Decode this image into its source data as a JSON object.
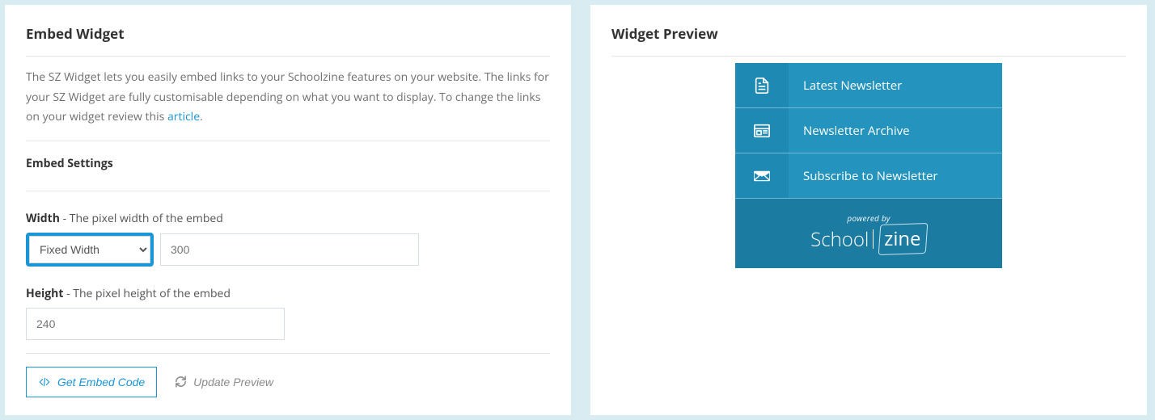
{
  "left": {
    "title": "Embed Widget",
    "desc_prefix": "The SZ Widget lets you easily embed links to your Schoolzine features on your website. The links for your SZ Widget are fully customisable depending on what you want to display. To change the links on your widget review this ",
    "desc_link_text": "article",
    "desc_suffix": ".",
    "settings_title": "Embed Settings",
    "width_label_strong": "Width",
    "width_label_rest": " - The pixel width of the embed",
    "width_select_value": "Fixed Width",
    "width_value": "300",
    "height_label_strong": "Height",
    "height_label_rest": " - The pixel height of the embed",
    "height_value": "240",
    "get_code_label": "Get Embed Code",
    "update_preview_label": "Update Preview"
  },
  "right": {
    "title": "Widget Preview",
    "rows": [
      {
        "label": "Latest Newsletter"
      },
      {
        "label": "Newsletter Archive"
      },
      {
        "label": "Subscribe to Newsletter"
      }
    ],
    "powered_by": "powered by",
    "brand_left": "School",
    "brand_right": "zine"
  }
}
